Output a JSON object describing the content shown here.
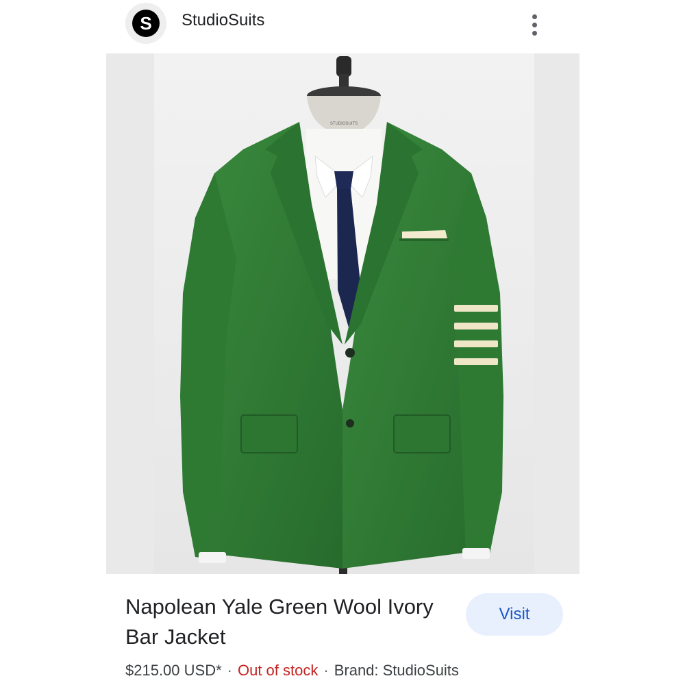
{
  "header": {
    "avatar_letter": "S",
    "site_name": "StudioSuits"
  },
  "product": {
    "title": "Napolean Yale Green Wool Ivory Bar Jacket",
    "price": "$215.00 USD*",
    "stock_status": "Out of stock",
    "brand": "Brand: StudioSuits",
    "mannequin_label": "STUDIOSUITS"
  },
  "actions": {
    "visit_label": "Visit"
  },
  "colors": {
    "jacket_green": "#2f7a35",
    "stock_red": "#c5221f",
    "visit_blue": "#1a56c4",
    "visit_bg": "#e8f0fe"
  }
}
